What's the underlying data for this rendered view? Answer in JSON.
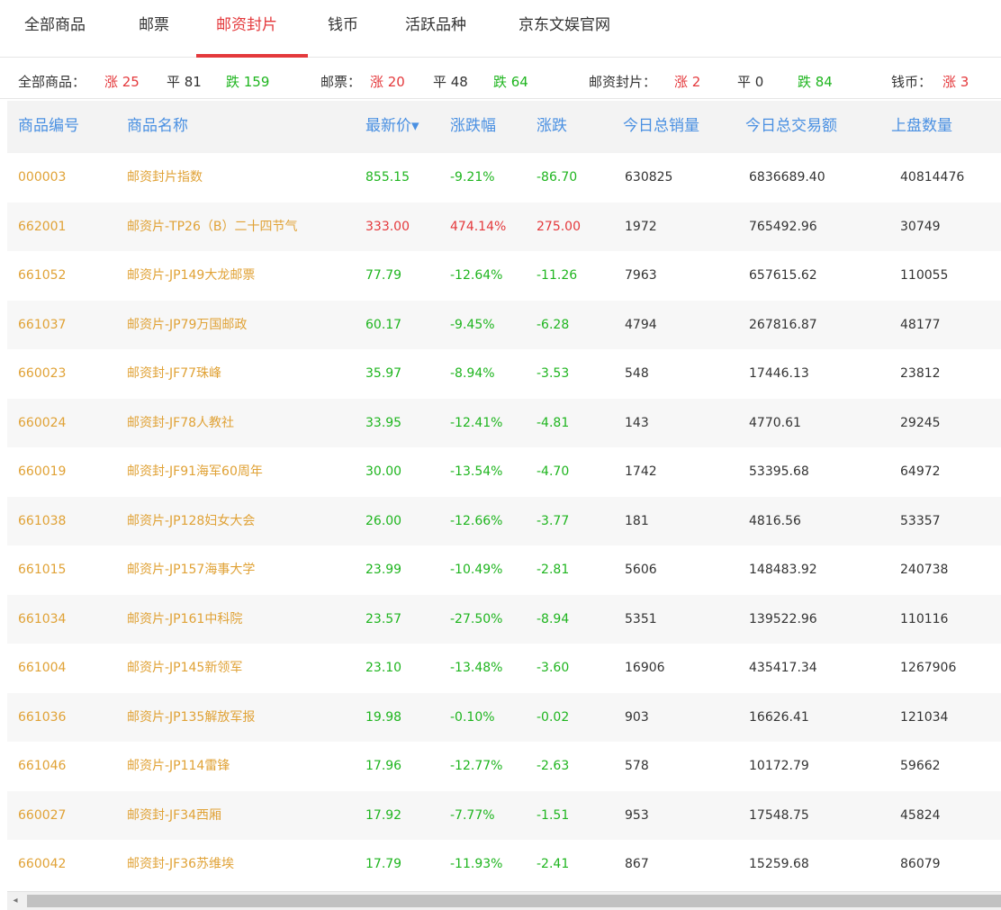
{
  "tabs": [
    {
      "label": "全部商品"
    },
    {
      "label": "邮票"
    },
    {
      "label": "邮资封片"
    },
    {
      "label": "钱币"
    },
    {
      "label": "活跃品种"
    },
    {
      "label": "京东文娱官网"
    }
  ],
  "active_tab": "邮资封片",
  "summary": {
    "all": {
      "label": "全部商品：",
      "up": "涨 25",
      "flat": "平 81",
      "down": "跌 159"
    },
    "stamp": {
      "label": "邮票：",
      "up": "涨 20",
      "flat": "平 48",
      "down": "跌 64"
    },
    "cover": {
      "label": "邮资封片：",
      "up": "涨 2",
      "flat": "平 0",
      "down": "跌 84"
    },
    "coin": {
      "label": "钱币：",
      "up": "涨 3"
    }
  },
  "columns": {
    "code": "商品编号",
    "name": "商品名称",
    "price": "最新价▾",
    "pct": "涨跌幅",
    "chg": "涨跌",
    "volume": "今日总销量",
    "amount": "今日总交易额",
    "listed": "上盘数量"
  },
  "rows": [
    {
      "code": "000003",
      "name": "邮资封片指数",
      "price": "855.15",
      "pct": "-9.21%",
      "chg": "-86.70",
      "volume": "630825",
      "amount": "6836689.40",
      "listed": "40814476",
      "dir": "down"
    },
    {
      "code": "662001",
      "name": "邮资片-TP26（B）二十四节气",
      "price": "333.00",
      "pct": "474.14%",
      "chg": "275.00",
      "volume": "1972",
      "amount": "765492.96",
      "listed": "30749",
      "dir": "up"
    },
    {
      "code": "661052",
      "name": "邮资片-JP149大龙邮票",
      "price": "77.79",
      "pct": "-12.64%",
      "chg": "-11.26",
      "volume": "7963",
      "amount": "657615.62",
      "listed": "110055",
      "dir": "down"
    },
    {
      "code": "661037",
      "name": "邮资片-JP79万国邮政",
      "price": "60.17",
      "pct": "-9.45%",
      "chg": "-6.28",
      "volume": "4794",
      "amount": "267816.87",
      "listed": "48177",
      "dir": "down"
    },
    {
      "code": "660023",
      "name": "邮资封-JF77珠峰",
      "price": "35.97",
      "pct": "-8.94%",
      "chg": "-3.53",
      "volume": "548",
      "amount": "17446.13",
      "listed": "23812",
      "dir": "down"
    },
    {
      "code": "660024",
      "name": "邮资封-JF78人教社",
      "price": "33.95",
      "pct": "-12.41%",
      "chg": "-4.81",
      "volume": "143",
      "amount": "4770.61",
      "listed": "29245",
      "dir": "down"
    },
    {
      "code": "660019",
      "name": "邮资封-JF91海军60周年",
      "price": "30.00",
      "pct": "-13.54%",
      "chg": "-4.70",
      "volume": "1742",
      "amount": "53395.68",
      "listed": "64972",
      "dir": "down"
    },
    {
      "code": "661038",
      "name": "邮资片-JP128妇女大会",
      "price": "26.00",
      "pct": "-12.66%",
      "chg": "-3.77",
      "volume": "181",
      "amount": "4816.56",
      "listed": "53357",
      "dir": "down"
    },
    {
      "code": "661015",
      "name": "邮资片-JP157海事大学",
      "price": "23.99",
      "pct": "-10.49%",
      "chg": "-2.81",
      "volume": "5606",
      "amount": "148483.92",
      "listed": "240738",
      "dir": "down"
    },
    {
      "code": "661034",
      "name": "邮资片-JP161中科院",
      "price": "23.57",
      "pct": "-27.50%",
      "chg": "-8.94",
      "volume": "5351",
      "amount": "139522.96",
      "listed": "110116",
      "dir": "down"
    },
    {
      "code": "661004",
      "name": "邮资片-JP145新领军",
      "price": "23.10",
      "pct": "-13.48%",
      "chg": "-3.60",
      "volume": "16906",
      "amount": "435417.34",
      "listed": "1267906",
      "dir": "down"
    },
    {
      "code": "661036",
      "name": "邮资片-JP135解放军报",
      "price": "19.98",
      "pct": "-0.10%",
      "chg": "-0.02",
      "volume": "903",
      "amount": "16626.41",
      "listed": "121034",
      "dir": "down"
    },
    {
      "code": "661046",
      "name": "邮资片-JP114雷锋",
      "price": "17.96",
      "pct": "-12.77%",
      "chg": "-2.63",
      "volume": "578",
      "amount": "10172.79",
      "listed": "59662",
      "dir": "down"
    },
    {
      "code": "660027",
      "name": "邮资封-JF34西厢",
      "price": "17.92",
      "pct": "-7.77%",
      "chg": "-1.51",
      "volume": "953",
      "amount": "17548.75",
      "listed": "45824",
      "dir": "down"
    },
    {
      "code": "660042",
      "name": "邮资封-JF36苏维埃",
      "price": "17.79",
      "pct": "-11.93%",
      "chg": "-2.41",
      "volume": "867",
      "amount": "15259.68",
      "listed": "86079",
      "dir": "down"
    }
  ],
  "colors": {
    "up": "#e4393c",
    "down": "#1fb51f",
    "header": "#4a90e2",
    "code": "#e0a236"
  },
  "scrollbar": {
    "left_arrow_icon": "◂"
  }
}
